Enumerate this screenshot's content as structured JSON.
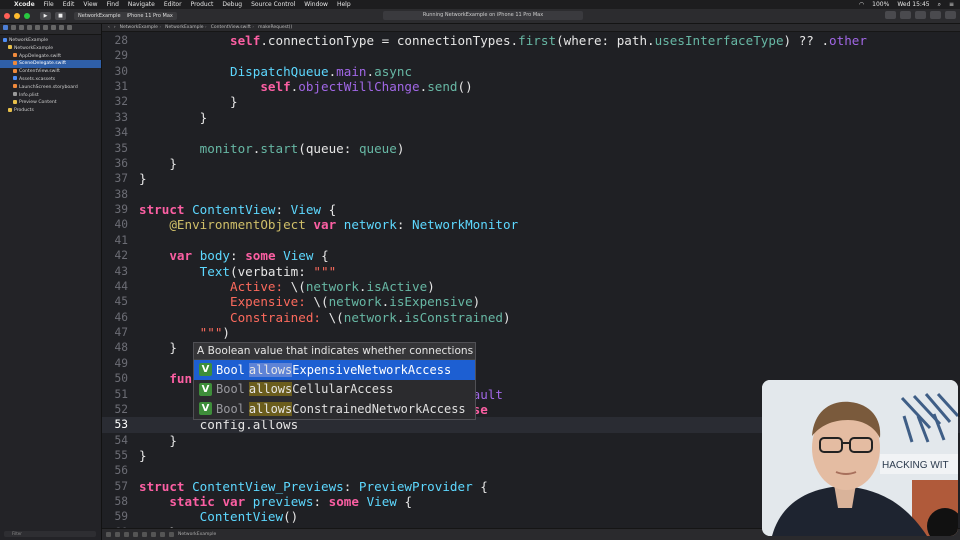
{
  "menubar": {
    "app": "Xcode",
    "items": [
      "File",
      "Edit",
      "View",
      "Find",
      "Navigate",
      "Editor",
      "Product",
      "Debug",
      "Source Control",
      "Window",
      "Help"
    ],
    "battery": "100%",
    "clock": "Wed 15:45"
  },
  "toolbar": {
    "scheme": "NetworkExample",
    "device": "iPhone 11 Pro Max",
    "status": "Running NetworkExample on iPhone 11 Pro Max"
  },
  "navigator": {
    "items": [
      {
        "label": "NetworkExample",
        "indent": 0,
        "icon": "blue"
      },
      {
        "label": "NetworkExample",
        "indent": 1,
        "icon": "yellow"
      },
      {
        "label": "AppDelegate.swift",
        "indent": 2,
        "icon": "orange"
      },
      {
        "label": "SceneDelegate.swift",
        "indent": 2,
        "icon": "orange",
        "selected": true
      },
      {
        "label": "ContentView.swift",
        "indent": 2,
        "icon": "orange"
      },
      {
        "label": "Assets.xcassets",
        "indent": 2,
        "icon": "blue"
      },
      {
        "label": "LaunchScreen.storyboard",
        "indent": 2,
        "icon": "orange"
      },
      {
        "label": "Info.plist",
        "indent": 2,
        "icon": "gray"
      },
      {
        "label": "Preview Content",
        "indent": 2,
        "icon": "yellow"
      },
      {
        "label": "Products",
        "indent": 1,
        "icon": "yellow"
      }
    ],
    "filter_placeholder": "Filter"
  },
  "jumpbar": {
    "crumbs": [
      "NetworkExample",
      "NetworkExample",
      "ContentView.swift",
      "makeRequest()"
    ]
  },
  "editor": {
    "current_line": 53,
    "lines": [
      {
        "n": "28",
        "segs": [
          [
            "",
            "            "
          ],
          [
            "kw",
            "self"
          ],
          [
            "",
            ".connectionType = connectionTypes."
          ],
          [
            "fn",
            "first"
          ],
          [
            "",
            "(where: path."
          ],
          [
            "fn",
            "usesInterfaceType"
          ],
          [
            "",
            ") ?? ."
          ],
          [
            "mem",
            "other"
          ]
        ]
      },
      {
        "n": "29",
        "segs": []
      },
      {
        "n": "30",
        "segs": [
          [
            "",
            "            "
          ],
          [
            "ty",
            "DispatchQueue"
          ],
          [
            "",
            "."
          ],
          [
            "mem",
            "main"
          ],
          [
            "",
            "."
          ],
          [
            "fn",
            "async"
          ],
          [
            "",
            "",
            " {"
          ]
        ]
      },
      {
        "n": "31",
        "segs": [
          [
            "",
            "                "
          ],
          [
            "kw",
            "self"
          ],
          [
            "",
            "."
          ],
          [
            "mem",
            "objectWillChange"
          ],
          [
            "",
            "."
          ],
          [
            "fn",
            "send"
          ],
          [
            "",
            "()"
          ]
        ]
      },
      {
        "n": "32",
        "segs": [
          [
            "",
            "            }"
          ]
        ]
      },
      {
        "n": "33",
        "segs": [
          [
            "",
            "        }"
          ]
        ]
      },
      {
        "n": "34",
        "segs": []
      },
      {
        "n": "35",
        "segs": [
          [
            "",
            "        "
          ],
          [
            "fn",
            "monitor"
          ],
          [
            "",
            "."
          ],
          [
            "fn",
            "start"
          ],
          [
            "",
            "(queue: "
          ],
          [
            "fn",
            "queue"
          ],
          [
            "",
            ")"
          ]
        ]
      },
      {
        "n": "36",
        "segs": [
          [
            "",
            "    }"
          ]
        ]
      },
      {
        "n": "37",
        "segs": [
          [
            "",
            "}"
          ]
        ]
      },
      {
        "n": "38",
        "segs": []
      },
      {
        "n": "39",
        "segs": [
          [
            "kw",
            "struct"
          ],
          [
            "",
            " "
          ],
          [
            "ty",
            "ContentView"
          ],
          [
            "",
            ": "
          ],
          [
            "ty",
            "View"
          ],
          [
            "",
            " {"
          ]
        ]
      },
      {
        "n": "40",
        "segs": [
          [
            "",
            "    "
          ],
          [
            "at",
            "@EnvironmentObject"
          ],
          [
            "",
            " "
          ],
          [
            "kw",
            "var"
          ],
          [
            "",
            " "
          ],
          [
            "ty",
            "network"
          ],
          [
            "",
            ": "
          ],
          [
            "ty",
            "NetworkMonitor"
          ]
        ]
      },
      {
        "n": "41",
        "segs": []
      },
      {
        "n": "42",
        "segs": [
          [
            "",
            "    "
          ],
          [
            "kw",
            "var"
          ],
          [
            "",
            " "
          ],
          [
            "ty",
            "body"
          ],
          [
            "",
            ": "
          ],
          [
            "kw",
            "some"
          ],
          [
            "",
            " "
          ],
          [
            "ty",
            "View"
          ],
          [
            "",
            " {"
          ]
        ]
      },
      {
        "n": "43",
        "segs": [
          [
            "",
            "        "
          ],
          [
            "ty",
            "Text"
          ],
          [
            "",
            "(verbatim: "
          ],
          [
            "str",
            "\"\"\""
          ]
        ]
      },
      {
        "n": "44",
        "segs": [
          [
            "",
            "            "
          ],
          [
            "str",
            "Active: "
          ],
          [
            "",
            "\\("
          ],
          [
            "fn",
            "network"
          ],
          [
            "",
            "."
          ],
          [
            "fn",
            "isActive"
          ],
          [
            "",
            ")"
          ]
        ]
      },
      {
        "n": "45",
        "segs": [
          [
            "",
            "            "
          ],
          [
            "str",
            "Expensive: "
          ],
          [
            "",
            "\\("
          ],
          [
            "fn",
            "network"
          ],
          [
            "",
            "."
          ],
          [
            "fn",
            "isExpensive"
          ],
          [
            "",
            ")"
          ]
        ]
      },
      {
        "n": "46",
        "segs": [
          [
            "",
            "            "
          ],
          [
            "str",
            "Constrained: "
          ],
          [
            "",
            "\\("
          ],
          [
            "fn",
            "network"
          ],
          [
            "",
            "."
          ],
          [
            "fn",
            "isConstrained"
          ],
          [
            "",
            ")"
          ]
        ]
      },
      {
        "n": "47",
        "segs": [
          [
            "",
            "        "
          ],
          [
            "str",
            "\"\"\""
          ],
          [
            "",
            ")"
          ]
        ]
      },
      {
        "n": "48",
        "segs": [
          [
            "",
            "    }"
          ]
        ]
      },
      {
        "n": "49",
        "segs": []
      },
      {
        "n": "50",
        "segs": [
          [
            "",
            "    "
          ],
          [
            "kw",
            "func"
          ]
        ]
      },
      {
        "n": "51",
        "segs": [
          [
            "",
            "                                         "
          ],
          [
            "mem",
            "default"
          ]
        ]
      },
      {
        "n": "52",
        "segs": [
          [
            "",
            "                                         "
          ],
          [
            "kw",
            "false"
          ]
        ]
      },
      {
        "n": "53",
        "segs": [
          [
            "",
            "        config.allows"
          ]
        ]
      },
      {
        "n": "54",
        "segs": [
          [
            "",
            "    }"
          ]
        ]
      },
      {
        "n": "55",
        "segs": [
          [
            "",
            "}"
          ]
        ]
      },
      {
        "n": "56",
        "segs": []
      },
      {
        "n": "57",
        "segs": [
          [
            "kw",
            "struct"
          ],
          [
            "",
            " "
          ],
          [
            "ty",
            "ContentView_Previews"
          ],
          [
            "",
            ": "
          ],
          [
            "ty",
            "PreviewProvider"
          ],
          [
            "",
            " {"
          ]
        ]
      },
      {
        "n": "58",
        "segs": [
          [
            "",
            "    "
          ],
          [
            "kw",
            "static"
          ],
          [
            "",
            " "
          ],
          [
            "kw",
            "var"
          ],
          [
            "",
            " "
          ],
          [
            "ty",
            "previews"
          ],
          [
            "",
            ": "
          ],
          [
            "kw",
            "some"
          ],
          [
            "",
            " "
          ],
          [
            "ty",
            "View"
          ],
          [
            "",
            " {"
          ]
        ]
      },
      {
        "n": "59",
        "segs": [
          [
            "",
            "        "
          ],
          [
            "ty",
            "ContentView"
          ],
          [
            "",
            "()"
          ]
        ]
      },
      {
        "n": "60",
        "segs": [
          [
            "",
            "    }"
          ]
        ]
      }
    ]
  },
  "autocomplete": {
    "description": "A Boolean value that indicates whether connections may use a network interface that the system considers expensive.",
    "items": [
      {
        "badge": "V",
        "type": "Bool",
        "match": "allows",
        "rest": "ExpensiveNetworkAccess",
        "selected": true
      },
      {
        "badge": "V",
        "type": "Bool",
        "match": "allows",
        "rest": "CellularAccess",
        "selected": false
      },
      {
        "badge": "V",
        "type": "Bool",
        "match": "allows",
        "rest": "ConstrainedNetworkAccess",
        "selected": false
      }
    ]
  },
  "debugbar": {
    "target": "NetworkExample"
  },
  "webcam": {
    "sign_text": "HACKING WIT"
  },
  "colors": {
    "editor_bg": "#1f2024",
    "keyword": "#fc5fa3",
    "type": "#5dd8ff",
    "string": "#fc6a5d",
    "selection": "#1d5fd2"
  }
}
